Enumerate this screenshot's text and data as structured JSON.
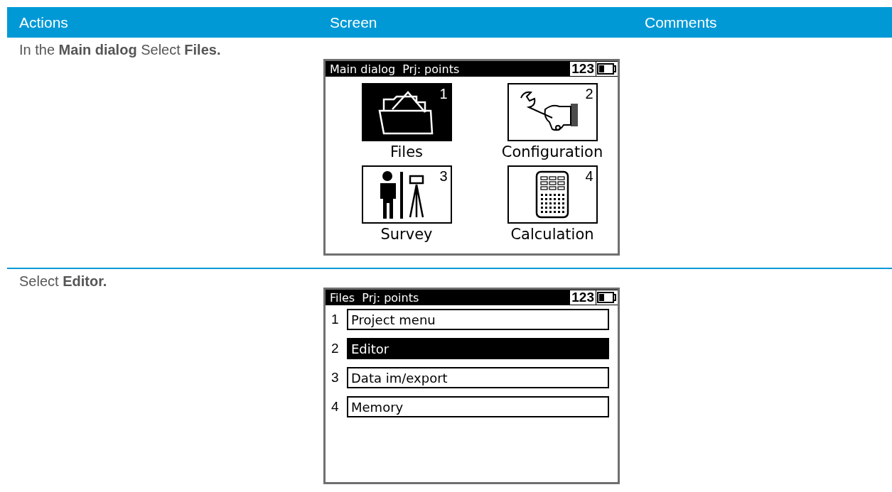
{
  "table": {
    "columns": [
      "Actions",
      "Screen",
      "Comments"
    ],
    "rows": [
      {
        "action": "In the **Main dialog** Select **Files.**",
        "screen": {
          "kind": "grid",
          "title": "Main dialog  Prj: points",
          "mode": "123",
          "tiles": [
            {
              "kind": "folder",
              "number": "1",
              "label": "Files",
              "selected": true
            },
            {
              "kind": "wrench",
              "number": "2",
              "label": "Configuration",
              "selected": false
            },
            {
              "kind": "survey",
              "number": "3",
              "label": "Survey",
              "selected": false
            },
            {
              "kind": "calculator",
              "number": "4",
              "label": "Calculation",
              "selected": false
            }
          ]
        }
      },
      {
        "action": "Select **Editor.**",
        "screen": {
          "kind": "list",
          "title": "Files  Prj: points",
          "mode": "123",
          "items": [
            {
              "number": "1",
              "label": "Project menu",
              "selected": false
            },
            {
              "number": "2",
              "label": "Editor",
              "selected": true
            },
            {
              "number": "3",
              "label": "Data im/export",
              "selected": false
            },
            {
              "number": "4",
              "label": "Memory",
              "selected": false
            }
          ]
        }
      }
    ]
  }
}
